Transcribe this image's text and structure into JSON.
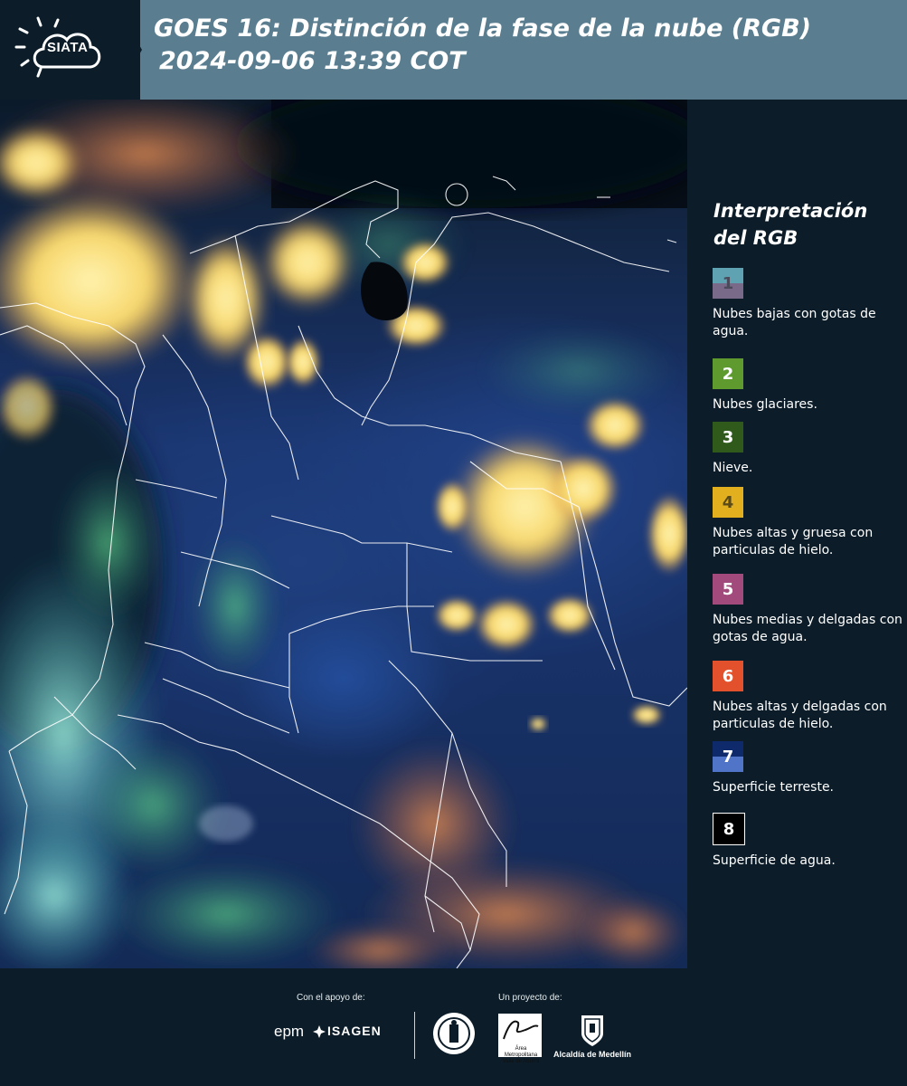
{
  "header": {
    "logo_text": "SIATA",
    "title_line1": "GOES 16: Distinción de la fase de la nube (RGB)",
    "title_line2": "2024-09-06 13:39 COT"
  },
  "legend": {
    "title_line1": "Interpretación",
    "title_line2": "del RGB",
    "items": [
      {
        "num": "1",
        "label": "Nubes bajas con gotas de agua.",
        "color_top": "#5fa3b3",
        "color_bottom": "#7a6a8a",
        "num_color": "#4a4a5a"
      },
      {
        "num": "2",
        "label": "Nubes glaciares.",
        "color_top": "#5e9a2e",
        "color_bottom": "#5e9a2e",
        "num_color": "#ffffff"
      },
      {
        "num": "3",
        "label": "Nieve.",
        "color_top": "#2f5a1c",
        "color_bottom": "#2f5a1c",
        "num_color": "#ffffff"
      },
      {
        "num": "4",
        "label": "Nubes altas y gruesa con particulas de hielo.",
        "color_top": "#e2b01f",
        "color_bottom": "#e2b01f",
        "num_color": "#5a4a1a"
      },
      {
        "num": "5",
        "label": "Nubes medias y delgadas con gotas de agua.",
        "color_top": "#a24a7c",
        "color_bottom": "#a24a7c",
        "num_color": "#ffffff"
      },
      {
        "num": "6",
        "label": "Nubes altas y delgadas con particulas de hielo.",
        "color_top": "#e2502c",
        "color_bottom": "#e2502c",
        "num_color": "#ffffff"
      },
      {
        "num": "7",
        "label": "Superficie terreste.",
        "color_top": "#0f2a6a",
        "color_bottom": "#4f74c8",
        "num_color": "#ffffff"
      },
      {
        "num": "8",
        "label": "Superficie de agua.",
        "color_top": "#000000",
        "color_bottom": "#000000",
        "num_color": "#ffffff"
      }
    ]
  },
  "footer": {
    "support_label": "Con el apoyo de:",
    "project_label": "Un proyecto de:",
    "sponsor1": "epm",
    "sponsor2": "ISAGEN",
    "partner1": "Área Metropolitana Valle de Aburrá",
    "partner2": "Alcaldía de Medellín"
  },
  "colors": {
    "header_bg": "#5a7e8f",
    "page_bg": "#0c1d29"
  }
}
